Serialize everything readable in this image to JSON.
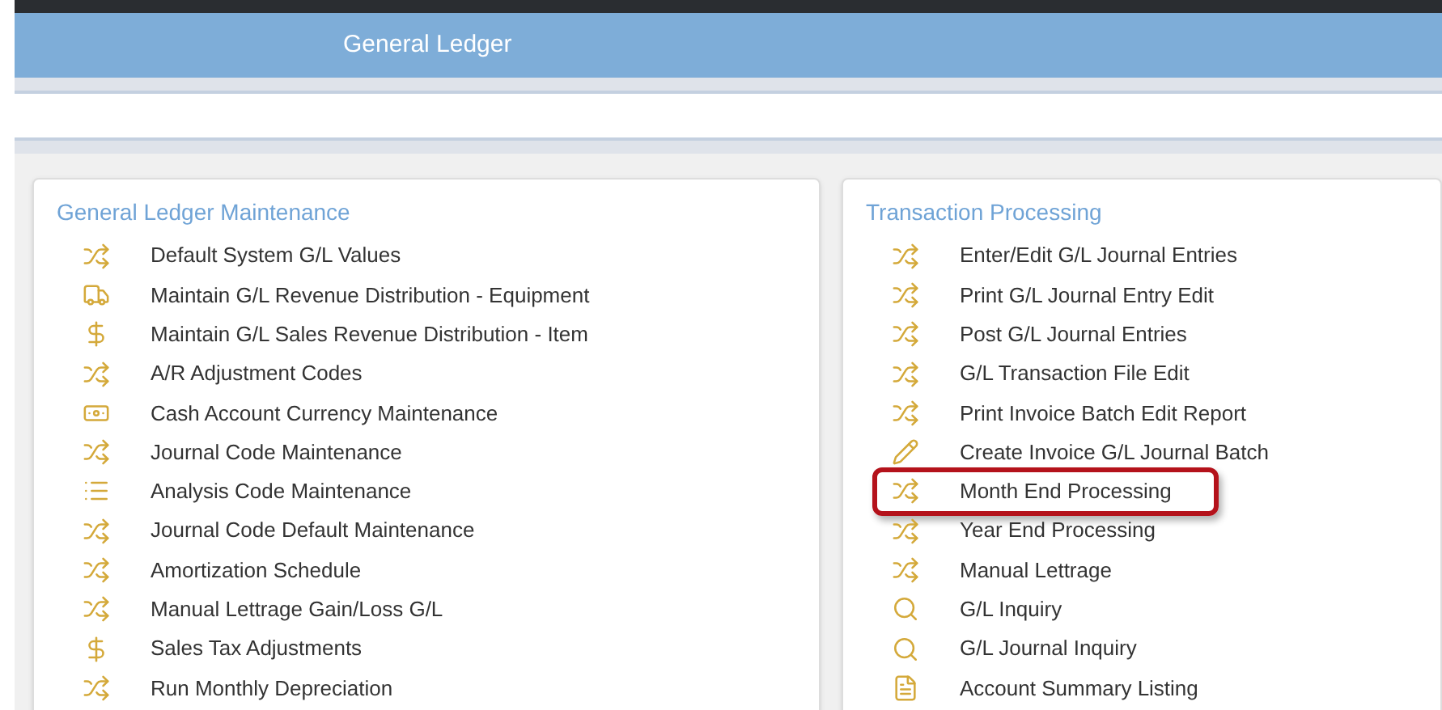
{
  "header": {
    "title": "General Ledger"
  },
  "panels": [
    {
      "title": "General Ledger Maintenance",
      "items": [
        {
          "label": "Default System G/L Values",
          "kind": "shuffle",
          "highlighted": false
        },
        {
          "label": "Maintain G/L Revenue Distribution - Equipment",
          "kind": "truck",
          "highlighted": false
        },
        {
          "label": "Maintain G/L Sales Revenue Distribution - Item",
          "kind": "dollar",
          "highlighted": false
        },
        {
          "label": "A/R Adjustment Codes",
          "kind": "shuffle",
          "highlighted": false
        },
        {
          "label": "Cash Account Currency Maintenance",
          "kind": "money",
          "highlighted": false
        },
        {
          "label": "Journal Code Maintenance",
          "kind": "shuffle",
          "highlighted": false
        },
        {
          "label": "Analysis Code Maintenance",
          "kind": "list",
          "highlighted": false
        },
        {
          "label": "Journal Code Default Maintenance",
          "kind": "shuffle",
          "highlighted": false
        },
        {
          "label": "Amortization Schedule",
          "kind": "shuffle",
          "highlighted": false
        },
        {
          "label": "Manual Lettrage Gain/Loss G/L",
          "kind": "shuffle",
          "highlighted": false
        },
        {
          "label": "Sales Tax Adjustments",
          "kind": "dollar",
          "highlighted": false
        },
        {
          "label": "Run Monthly Depreciation",
          "kind": "shuffle",
          "highlighted": false
        }
      ]
    },
    {
      "title": "Transaction Processing",
      "items": [
        {
          "label": "Enter/Edit G/L Journal Entries",
          "kind": "shuffle",
          "highlighted": false
        },
        {
          "label": "Print G/L Journal Entry Edit",
          "kind": "shuffle",
          "highlighted": false
        },
        {
          "label": "Post G/L Journal Entries",
          "kind": "shuffle",
          "highlighted": false
        },
        {
          "label": "G/L Transaction File Edit",
          "kind": "shuffle",
          "highlighted": false
        },
        {
          "label": "Print Invoice Batch Edit Report",
          "kind": "shuffle",
          "highlighted": false
        },
        {
          "label": "Create Invoice G/L Journal Batch",
          "kind": "pencil",
          "highlighted": false
        },
        {
          "label": "Month End Processing",
          "kind": "shuffle",
          "highlighted": true
        },
        {
          "label": "Year End Processing",
          "kind": "shuffle",
          "highlighted": false
        },
        {
          "label": "Manual Lettrage",
          "kind": "shuffle",
          "highlighted": false
        },
        {
          "label": "G/L Inquiry",
          "kind": "search",
          "highlighted": false
        },
        {
          "label": "G/L Journal Inquiry",
          "kind": "search",
          "highlighted": false
        },
        {
          "label": "Account Summary Listing",
          "kind": "file",
          "highlighted": false
        }
      ]
    }
  ]
}
